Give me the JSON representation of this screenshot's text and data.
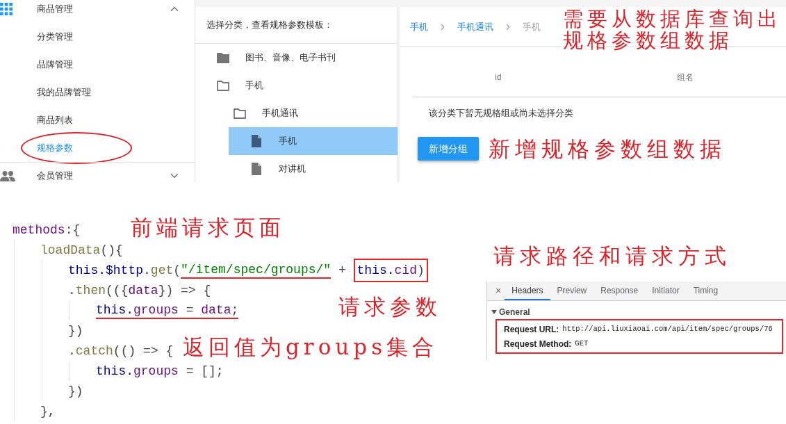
{
  "sidebar": {
    "groups": [
      {
        "label": "商品管理",
        "expanded": true,
        "items": [
          {
            "label": "分类管理",
            "selected": false,
            "circled": false
          },
          {
            "label": "品牌管理",
            "selected": false,
            "circled": false
          },
          {
            "label": "我的品牌管理",
            "selected": false,
            "circled": false
          },
          {
            "label": "商品列表",
            "selected": false,
            "circled": false
          },
          {
            "label": "规格参数",
            "selected": true,
            "circled": true
          }
        ]
      },
      {
        "label": "会员管理",
        "expanded": false
      }
    ]
  },
  "tree": {
    "title": "选择分类，查看规格参数模板：",
    "items": [
      {
        "kind": "folder",
        "label": "图书、音像、电子书刊",
        "expanded": false,
        "selected": false
      },
      {
        "kind": "folder",
        "label": "手机",
        "expanded": true,
        "selected": false,
        "children": [
          {
            "kind": "folder",
            "label": "手机通讯",
            "expanded": true,
            "selected": false,
            "children": [
              {
                "kind": "file",
                "label": "手机",
                "selected": true
              },
              {
                "kind": "file",
                "label": "对讲机",
                "selected": false
              }
            ]
          }
        ]
      }
    ]
  },
  "spec_groups": {
    "breadcrumb": [
      {
        "label": "手机",
        "current": false
      },
      {
        "label": "手机通讯",
        "current": false
      },
      {
        "label": "手机",
        "current": true
      }
    ],
    "annotation": [
      "需要从数据库查询出",
      "规格参数组数据"
    ],
    "columns": [
      "id",
      "组名"
    ],
    "empty_message": "该分类下暂无规格组或尚未选择分类",
    "add_button": "新增分组",
    "add_note": "新增规格参数组数据"
  },
  "code": {
    "notes": [
      "前端请求页面",
      "请求参数",
      "返回值为groups集合"
    ],
    "lines": [
      {
        "segments": [
          {
            "kind": "plain",
            "tokens": [
              {
                "kind": "property",
                "text": "methods"
              },
              {
                "kind": "punct",
                "text": ":{"
              }
            ]
          }
        ],
        "children": [
          {
            "segments": [
              {
                "kind": "plain",
                "tokens": [
                  {
                    "kind": "method",
                    "text": "loadData"
                  },
                  {
                    "kind": "punct",
                    "text": "(){"
                  }
                ]
              }
            ],
            "children": [
              {
                "segments": [
                  {
                    "kind": "plain",
                    "tokens": [
                      {
                        "kind": "keyword",
                        "text": "this."
                      },
                      {
                        "kind": "global",
                        "text": "$http"
                      },
                      {
                        "kind": "punct",
                        "text": "."
                      },
                      {
                        "kind": "method",
                        "text": "get"
                      },
                      {
                        "kind": "punct",
                        "text": "("
                      }
                    ]
                  },
                  {
                    "kind": "underlined",
                    "tokens": [
                      {
                        "kind": "string",
                        "text": "\"/item/spec/groups/\""
                      }
                    ]
                  },
                  {
                    "kind": "plain",
                    "tokens": [
                      {
                        "kind": "punct",
                        "text": " + "
                      }
                    ]
                  },
                  {
                    "kind": "boxed",
                    "tokens": [
                      {
                        "kind": "keyword",
                        "text": "this."
                      },
                      {
                        "kind": "property",
                        "text": "cid"
                      },
                      {
                        "kind": "punct",
                        "text": ")"
                      }
                    ]
                  }
                ]
              },
              {
                "segments": [
                  {
                    "kind": "plain",
                    "tokens": [
                      {
                        "kind": "punct",
                        "text": "."
                      },
                      {
                        "kind": "method",
                        "text": "then"
                      },
                      {
                        "kind": "punct",
                        "text": "(({"
                      },
                      {
                        "kind": "property",
                        "text": "data"
                      },
                      {
                        "kind": "punct",
                        "text": "}) => {"
                      }
                    ]
                  }
                ],
                "children": [
                  {
                    "segments": [
                      {
                        "kind": "underlined",
                        "tokens": [
                          {
                            "kind": "keyword",
                            "text": "this."
                          },
                          {
                            "kind": "property",
                            "text": "groups"
                          },
                          {
                            "kind": "punct",
                            "text": " = "
                          },
                          {
                            "kind": "property",
                            "text": "data"
                          },
                          {
                            "kind": "punct",
                            "text": ";"
                          }
                        ]
                      }
                    ]
                  }
                ]
              },
              {
                "segments": [
                  {
                    "kind": "plain",
                    "tokens": [
                      {
                        "kind": "punct",
                        "text": "})"
                      }
                    ]
                  }
                ]
              },
              {
                "segments": [
                  {
                    "kind": "plain",
                    "tokens": [
                      {
                        "kind": "punct",
                        "text": "."
                      },
                      {
                        "kind": "method",
                        "text": "catch"
                      },
                      {
                        "kind": "punct",
                        "text": "(() => {"
                      }
                    ]
                  }
                ],
                "children": [
                  {
                    "segments": [
                      {
                        "kind": "plain",
                        "tokens": [
                          {
                            "kind": "keyword",
                            "text": "this."
                          },
                          {
                            "kind": "property",
                            "text": "groups"
                          },
                          {
                            "kind": "punct",
                            "text": " = [];"
                          }
                        ]
                      }
                    ]
                  }
                ]
              },
              {
                "segments": [
                  {
                    "kind": "plain",
                    "tokens": [
                      {
                        "kind": "punct",
                        "text": "})"
                      }
                    ]
                  }
                ]
              }
            ]
          },
          {
            "segments": [
              {
                "kind": "plain",
                "tokens": [
                  {
                    "kind": "punct",
                    "text": "},"
                  }
                ]
              }
            ]
          }
        ]
      }
    ]
  },
  "devtools": {
    "note": "请求路径和请求方式",
    "close": "×",
    "tabs": [
      {
        "label": "Headers",
        "selected": true
      },
      {
        "label": "Preview",
        "selected": false
      },
      {
        "label": "Response",
        "selected": false
      },
      {
        "label": "Initiator",
        "selected": false
      },
      {
        "label": "Timing",
        "selected": false
      }
    ],
    "general": {
      "label": "General",
      "expanded": true,
      "boxed": true,
      "rows": [
        {
          "label": "Request URL:",
          "value": "http://api.liuxiaoai.com/api/item/spec/groups/76"
        },
        {
          "label": "Request Method:",
          "value": "GET"
        }
      ]
    }
  }
}
